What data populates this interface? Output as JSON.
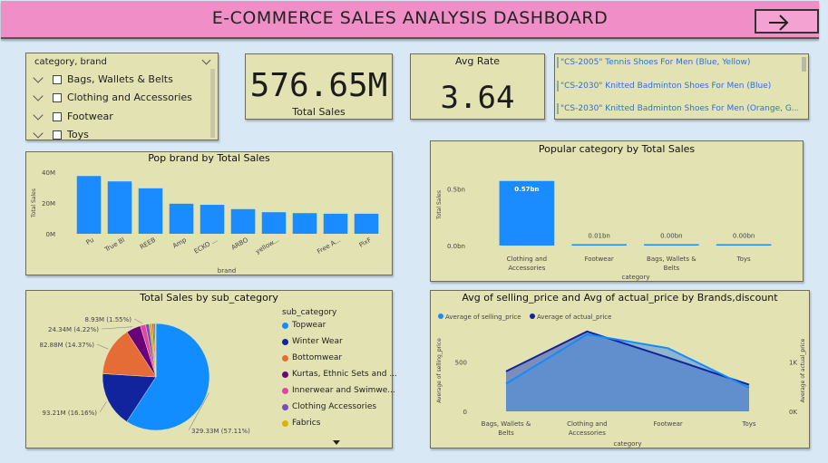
{
  "header": {
    "title": "E-COMMERCE SALES ANALYSIS DASHBOARD"
  },
  "slicer": {
    "header": "category, brand",
    "items": [
      "Bags, Wallets & Belts",
      "Clothing and Accessories",
      "Footwear",
      "Toys"
    ]
  },
  "kpi_total_sales": {
    "value": "576.65M",
    "label": "Total Sales"
  },
  "kpi_avg_rate": {
    "value": "3.64",
    "label": "Avg Rate"
  },
  "products": [
    "\"CS-2005\" Tennis Shoes For Men  (Blue, Yellow)",
    "\"CS-2030\" Knitted Badminton Shoes For Men  (Blue)",
    "\"CS-2030\" Knitted Badminton Shoes For Men  (Orange, G..."
  ],
  "chart_data": [
    {
      "type": "bar",
      "title": "Pop brand by Total Sales",
      "xlabel": "brand",
      "ylabel": "Total Sales",
      "categories": [
        "Pu",
        "True Bl",
        "REEB",
        "Amp",
        "ECKO ...",
        "ARBO",
        "yellow...",
        "",
        "Free A...",
        "PixF"
      ],
      "values": [
        37.5,
        34,
        29.5,
        19.5,
        18.8,
        16,
        14,
        13.4,
        13,
        13
      ],
      "yticks": [
        "0M",
        "20M",
        "40M"
      ],
      "ylim": [
        0,
        40
      ],
      "color": "#1a8cff"
    },
    {
      "type": "bar",
      "title": "Popular category by Total Sales",
      "xlabel": "category",
      "ylabel": "Total Sales",
      "categories": [
        "Clothing and Accessories",
        "Footwear",
        "Bags, Wallets & Belts",
        "Toys"
      ],
      "values": [
        0.57,
        0.01,
        0.0,
        0.0
      ],
      "data_labels": [
        "0.57bn",
        "0.01bn",
        "0.00bn",
        "0.00bn"
      ],
      "yticks": [
        "0.0bn",
        "0.5bn"
      ],
      "ylim": [
        0,
        0.6
      ],
      "color": "#1a8cff"
    },
    {
      "type": "pie",
      "title": "Total Sales by sub_category",
      "legend_title": "sub_category",
      "series": [
        {
          "name": "Topwear",
          "value": 329.33,
          "label": "329.33M (57.11%)",
          "color": "#118dff"
        },
        {
          "name": "Winter Wear",
          "value": 93.21,
          "label": "93.21M (16.16%)",
          "color": "#12239e"
        },
        {
          "name": "Bottomwear",
          "value": 82.88,
          "label": "82.88M (14.37%)",
          "color": "#e66c37"
        },
        {
          "name": "Kurtas, Ethnic Sets and ...",
          "value": 24.34,
          "label": "24.34M (4.22%)",
          "color": "#6b007b"
        },
        {
          "name": "Innerwear and Swimwe...",
          "value": 8.93,
          "label": "8.93M (1.55%)",
          "color": "#e044a7"
        },
        {
          "name": "Clothing Accessories",
          "value": 6.0,
          "label": "",
          "color": "#744ec2"
        },
        {
          "name": "Fabrics",
          "value": 5.0,
          "label": "",
          "color": "#d9b300"
        },
        {
          "name": "",
          "value": 3.0,
          "label": "",
          "color": "#d64550"
        },
        {
          "name": "",
          "value": 2.0,
          "label": "",
          "color": "#197278"
        },
        {
          "name": "",
          "value": 1.5,
          "label": "",
          "color": "#8ab6e0"
        }
      ]
    },
    {
      "type": "area",
      "title": "Avg of selling_price and Avg of actual_price by Brands,discount",
      "xlabel": "category",
      "ylabel": "Average of selling_price",
      "y2label": "Average of actual_price",
      "categories": [
        "Bags, Wallets & Belts",
        "Clothing and Accessories",
        "Footwear",
        "Toys"
      ],
      "yticks": [
        "0",
        "500"
      ],
      "y2ticks": [
        "0K",
        "1K"
      ],
      "series": [
        {
          "name": "Average of selling_price",
          "color": "#118dff",
          "values": [
            280,
            780,
            640,
            240
          ]
        },
        {
          "name": "Average of actual_price",
          "color": "#12239e",
          "values": [
            810,
            1620,
            1090,
            540
          ]
        }
      ],
      "ylim": [
        0,
        900
      ],
      "y2lim": [
        0,
        1800
      ]
    }
  ]
}
